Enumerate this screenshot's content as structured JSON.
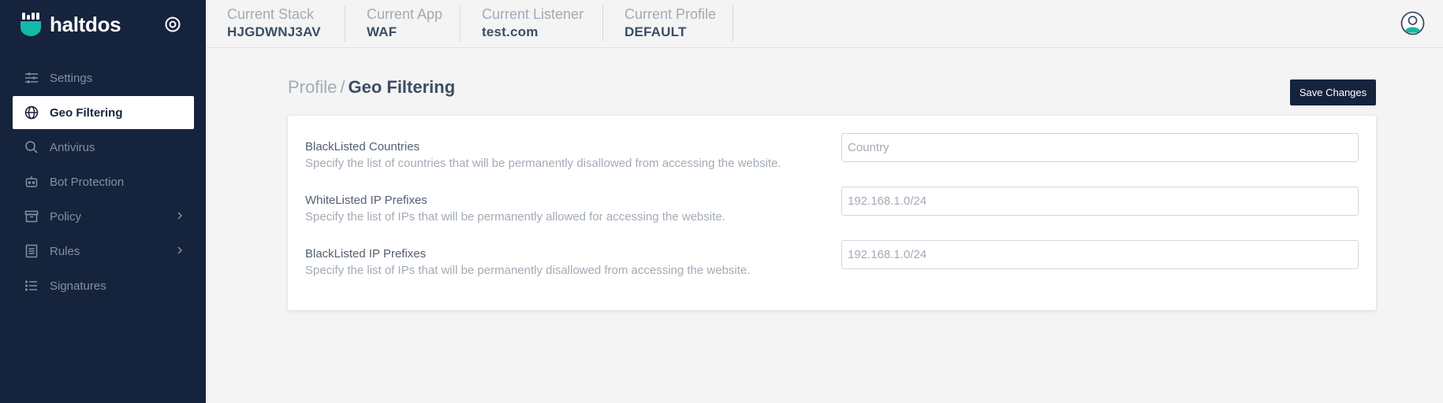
{
  "app": {
    "name": "haltdos"
  },
  "sidebar": {
    "items": [
      {
        "label": "Settings",
        "icon": "sliders-icon",
        "active": false,
        "has_children": false
      },
      {
        "label": "Geo Filtering",
        "icon": "globe-icon",
        "active": true,
        "has_children": false
      },
      {
        "label": "Antivirus",
        "icon": "search-icon",
        "active": false,
        "has_children": false
      },
      {
        "label": "Bot Protection",
        "icon": "robot-icon",
        "active": false,
        "has_children": false
      },
      {
        "label": "Policy",
        "icon": "archive-icon",
        "active": false,
        "has_children": true
      },
      {
        "label": "Rules",
        "icon": "list-box-icon",
        "active": false,
        "has_children": true
      },
      {
        "label": "Signatures",
        "icon": "list-icon",
        "active": false,
        "has_children": false
      }
    ]
  },
  "topbar": {
    "stack": {
      "label": "Current Stack",
      "value": "HJGDWNJ3AV"
    },
    "app": {
      "label": "Current App",
      "value": "WAF"
    },
    "listener": {
      "label": "Current Listener",
      "value": "test.com"
    },
    "profile": {
      "label": "Current Profile",
      "value": "DEFAULT"
    }
  },
  "breadcrumb": {
    "parent": "Profile",
    "separator": "/",
    "current": "Geo Filtering"
  },
  "actions": {
    "save_label": "Save Changes"
  },
  "form": {
    "rows": [
      {
        "title": "BlackListed Countries",
        "description": "Specify the list of countries that will be permanently disallowed from accessing the website.",
        "placeholder": "Country",
        "value": ""
      },
      {
        "title": "WhiteListed IP Prefixes",
        "description": "Specify the list of IPs that will be permanently allowed for accessing the website.",
        "placeholder": "192.168.1.0/24",
        "value": ""
      },
      {
        "title": "BlackListed IP Prefixes",
        "description": "Specify the list of IPs that will be permanently disallowed from accessing the website.",
        "placeholder": "192.168.1.0/24",
        "value": ""
      }
    ]
  },
  "colors": {
    "sidebar_bg": "#15233d",
    "accent": "#14b8a6",
    "page_bg": "#f3f4f3"
  }
}
